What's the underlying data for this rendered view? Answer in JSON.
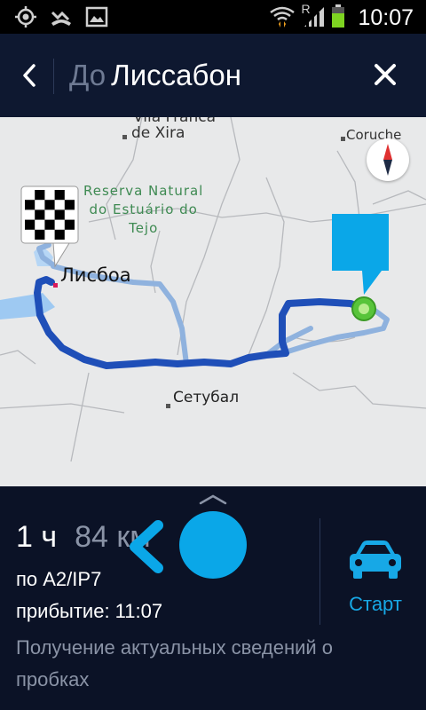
{
  "status_bar": {
    "time": "10:07",
    "network_label": "R",
    "icons": [
      "gps-icon",
      "missed-call-icon",
      "gallery-icon",
      "wifi-icon",
      "signal-icon",
      "battery-icon"
    ]
  },
  "header": {
    "prefix": "До",
    "destination": "Лиссабон",
    "back_icon": "chevron-left-icon",
    "close_icon": "close-icon"
  },
  "map": {
    "labels": {
      "vila": "Vila Franca",
      "xira": "de Xira",
      "coruche": "Coruche",
      "reserva": [
        "Reserva Natural",
        "do Estuário do",
        "Tejo"
      ],
      "lisboa": "Лисбоа",
      "setubal": "Сетубал"
    },
    "compass_icon": "compass-icon",
    "colors": {
      "route_main": "#1f4fb8",
      "route_alt": "#8fb2de",
      "water": "#9ec9f2",
      "start_flag": "#0aa7e8",
      "start_marker": "#58c43a"
    }
  },
  "panel": {
    "duration": "1 ч",
    "distance": "84 км",
    "via": "по A2/IP7",
    "arrival": "прибытие: 11:07",
    "traffic_status": "Получение актуальных сведений о пробках",
    "start_label": "Старт",
    "start_icon": "car-icon",
    "handle_icon": "chevron-up-icon"
  }
}
